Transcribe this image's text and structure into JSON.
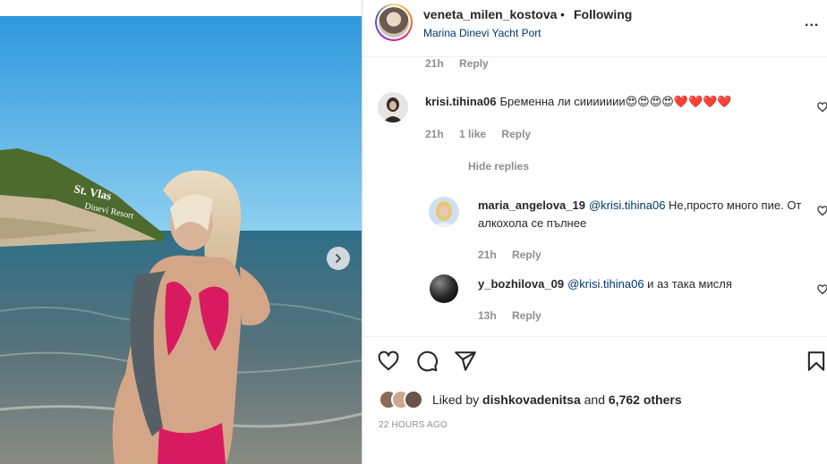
{
  "post": {
    "username": "veneta_milen_kostova",
    "separator": "•",
    "follow_status": "Following",
    "location": "Marina Dinevi Yacht Port",
    "more_label": "..."
  },
  "media": {
    "sign_line1": "St. Vlas",
    "sign_line2": "Dinevi Resort"
  },
  "comments": [
    {
      "time": "21h",
      "reply_label": "Reply"
    },
    {
      "username": "krisi.tihina06",
      "text": "Бременна ли сиииииии😍😍😍😍❤️❤️❤️❤️",
      "time": "21h",
      "likes": "1 like",
      "reply_label": "Reply",
      "hide_replies": "Hide replies",
      "replies": [
        {
          "username": "maria_angelova_19",
          "mention": "@krisi.tihina06",
          "text": " Не,просто много пие. От алкохола се пълнее",
          "time": "21h",
          "reply_label": "Reply"
        },
        {
          "username": "y_bozhilova_09",
          "mention": "@krisi.tihina06",
          "text": " и аз така мисля",
          "time": "13h",
          "reply_label": "Reply"
        }
      ]
    }
  ],
  "likes": {
    "prefix": "Liked by ",
    "user": "dishkovadenitsa",
    "middle": " and ",
    "count": "6,762 others"
  },
  "timestamp": "22 HOURS AGO",
  "icons": {
    "like": "heart-icon",
    "comment": "comment-icon",
    "share": "share-icon",
    "save": "bookmark-icon",
    "next": "chevron-right-icon"
  }
}
